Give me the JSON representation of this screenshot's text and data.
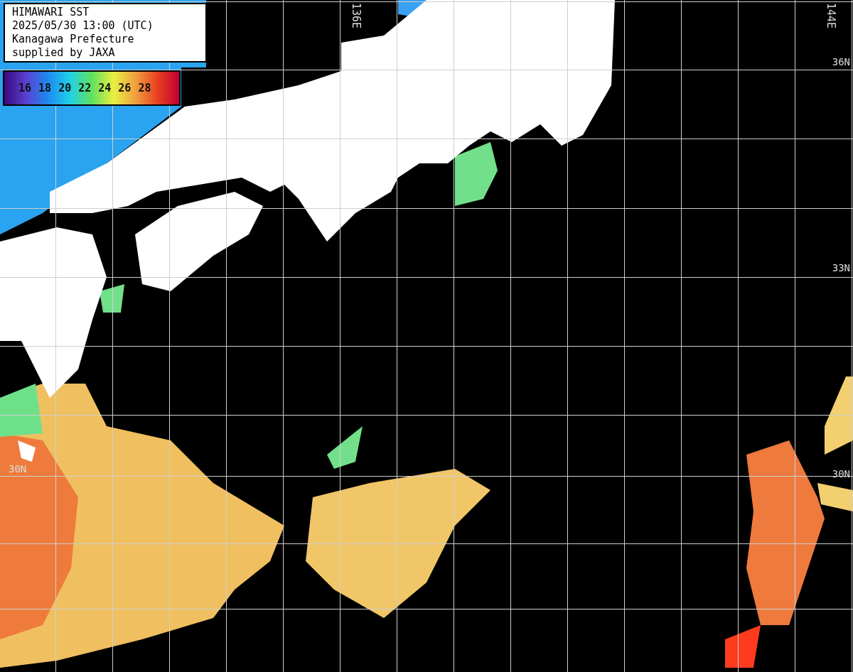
{
  "info_box": {
    "lines": [
      "HIMAWARI SST",
      "2025/05/30 13:00 (UTC)",
      "Kanagawa Prefecture",
      "supplied by JAXA"
    ]
  },
  "legend": {
    "ticks": [
      "16",
      "18",
      "20",
      "22",
      "24",
      "26",
      "28"
    ]
  },
  "longitude_labels": [
    "136E",
    "144E"
  ],
  "left_latitude_labels": [
    "30N"
  ],
  "right_latitude_labels": [
    "36N",
    "33N",
    "30N"
  ]
}
